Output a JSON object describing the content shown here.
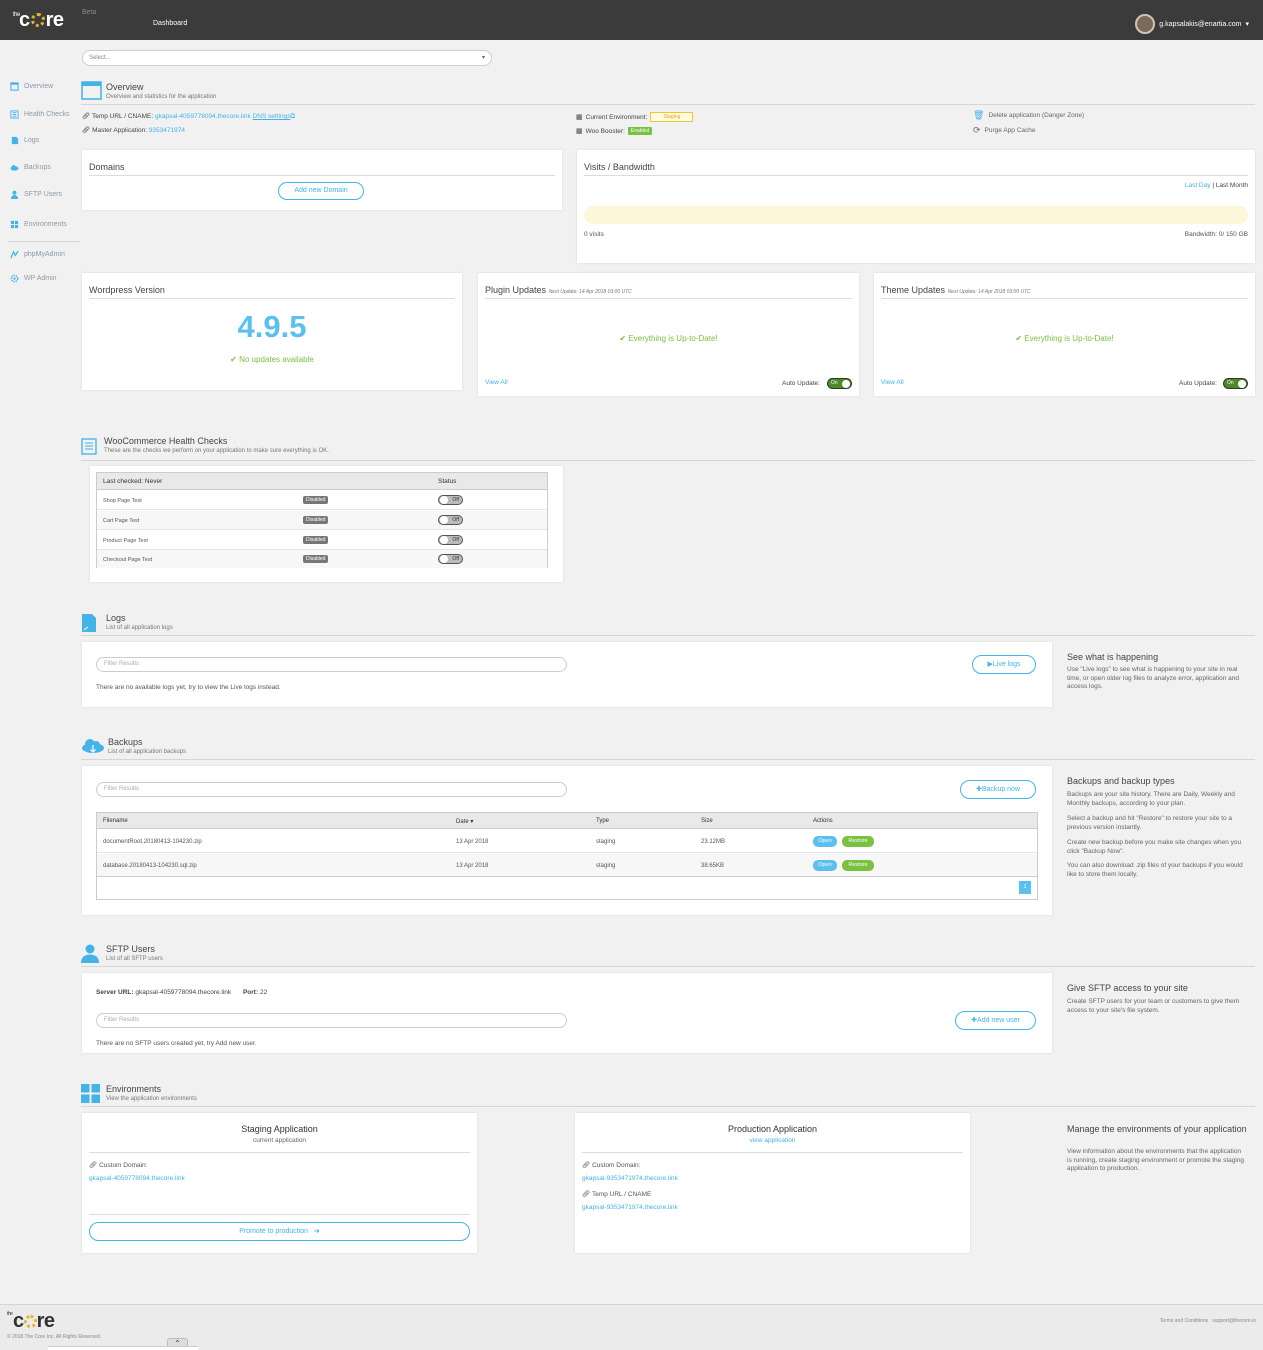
{
  "header": {
    "logo_the": "the",
    "logo_text": "core",
    "beta": "Beta",
    "nav_dashboard": "Dashboard",
    "user_email": "g.kapsalakis@enartia.com"
  },
  "app_select": {
    "placeholder": "Select..."
  },
  "sidebar": {
    "items": [
      {
        "label": "Overview"
      },
      {
        "label": "Health Checks"
      },
      {
        "label": "Logs"
      },
      {
        "label": "Backups"
      },
      {
        "label": "SFTP Users"
      },
      {
        "label": "Environments"
      },
      {
        "label": "phpMyAdmin"
      },
      {
        "label": "WP Admin"
      }
    ]
  },
  "overview": {
    "title": "Overview",
    "subtitle": "Overview and statistics for the application",
    "temp_url_label": "Temp URL / CNAME:",
    "temp_url_value": "gkapsal-4059778094.thecore.link",
    "dns_settings": "DNS settings",
    "master_app_label": "Master Application:",
    "master_app_value": "9353471974",
    "current_env_label": "Current Environment:",
    "current_env_value": "Staging",
    "woo_booster_label": "Woo Booster:",
    "woo_booster_value": "Enabled",
    "delete_app": "Delete application (Danger Zone)",
    "purge_cache": "Purge App Cache"
  },
  "domains": {
    "title": "Domains",
    "add_button": "Add new Domain"
  },
  "visits": {
    "title": "Visits / Bandwidth",
    "last_day": "Last Day",
    "separator": "|",
    "last_month": "Last Month",
    "visits_text": "0 visits",
    "bandwidth_text": "Bandwidth: 0/ 150 GB"
  },
  "wordpress": {
    "title": "Wordpress Version",
    "version": "4.9.5",
    "status": "No updates available"
  },
  "plugins": {
    "title": "Plugin Updates",
    "next_update": "Next Update: 14 Apr 2018 03:00 UTC",
    "status": "Everything is Up-to-Date!",
    "view_all": "View All",
    "auto_update_label": "Auto Update:",
    "toggle_label": "On"
  },
  "themes": {
    "title": "Theme Updates",
    "next_update": "Next Update: 14 Apr 2018 03:00 UTC",
    "status": "Everything is Up-to-Date!",
    "view_all": "View All",
    "auto_update_label": "Auto Update:",
    "toggle_label": "On"
  },
  "health": {
    "title": "WooCommerce Health Checks",
    "subtitle": "These are the checks we perform on your application to make sure everything is OK.",
    "col_last_checked": "Last checked: Never",
    "col_status": "Status",
    "rows": [
      {
        "name": "Shop Page Test",
        "badge": "Disabled",
        "toggle": "Off"
      },
      {
        "name": "Cart Page Test",
        "badge": "Disabled",
        "toggle": "Off"
      },
      {
        "name": "Product Page Test",
        "badge": "Disabled",
        "toggle": "Off"
      },
      {
        "name": "Checkout Page Test",
        "badge": "Disabled",
        "toggle": "Off"
      }
    ]
  },
  "logs": {
    "title": "Logs",
    "subtitle": "List of all application logs",
    "filter_placeholder": "Filter Results",
    "live_logs_button": "Live logs",
    "empty_text": "There are no available logs yet, try to view the Live logs instead.",
    "side_title": "See what is happening",
    "side_body": "Use \"Live logs\" to see what is happening to your site in real time, or open older log files to analyze error, application and access logs."
  },
  "backups": {
    "title": "Backups",
    "subtitle": "List of all application backups",
    "filter_placeholder": "Filter Results",
    "backup_now_button": "Backup now",
    "columns": [
      "Filename",
      "Date ▾",
      "Type",
      "Size",
      "Actions"
    ],
    "rows": [
      {
        "filename": "documentRoot.20180413-104230.zip",
        "date": "13 Apr 2018",
        "type": "staging",
        "size": "23.12MB",
        "open": "Open",
        "restore": "Restore"
      },
      {
        "filename": "database.20180413-104230.sql.zip",
        "date": "13 Apr 2018",
        "type": "staging",
        "size": "38.65KB",
        "open": "Open",
        "restore": "Restore"
      }
    ],
    "page": "1",
    "side_title": "Backups and backup types",
    "side_p1": "Backups are your site history. There are Daily, Weekly and Monthly backups, according to your plan.",
    "side_p2": "Select a backup and hit \"Restore\" to restore your site to a previous version instantly.",
    "side_p3": "Create new backup before you make site changes when you click \"Backup Now\".",
    "side_p4": "You can also download .zip files of your backups if you would like to store them locally."
  },
  "sftp": {
    "title": "SFTP Users",
    "subtitle": "List of all SFTP users",
    "server_url_label": "Server URL:",
    "server_url_value": "gkapsal-4059778094.thecore.link",
    "port_label": "Port:",
    "port_value": "22",
    "filter_placeholder": "Filter Results",
    "add_user_button": "Add new user",
    "empty_text": "There are no SFTP users created yet, try Add new user.",
    "side_title": "Give SFTP access to your site",
    "side_body": "Create SFTP users for your team or customers to give them access to your site's file system."
  },
  "environments": {
    "title": "Environments",
    "subtitle": "View the application environments",
    "staging_title": "Staging Application",
    "staging_sub": "current application",
    "staging_domain_label": "Custom Domain:",
    "staging_domain_value": "gkapsal-4059778094.thecore.link",
    "promote_button": "Promote to production",
    "production_title": "Production Application",
    "production_link": "view application",
    "production_domain_label": "Custom Domain:",
    "production_domain_value": "gkapsal-9353471974.thecore.link",
    "production_temp_label": "Temp URL / CNAME",
    "production_temp_value": "gkapsal-9353471974.thecore.link",
    "side_title": "Manage the environments of your application",
    "side_body": "View information about the environments that the application is running, create staging environment or promote the staging application to production."
  },
  "footer": {
    "logo_the": "the",
    "logo_text": "core",
    "copyright": "© 2018 The Core Inc. All Rights Reserved.",
    "terms": "Terms and Conditions",
    "support": "support@thecore.io",
    "scroll_up": "⌃"
  },
  "colors": {
    "accent": "#43b3e8",
    "success": "#7ac142",
    "header": "#3b3b3b",
    "warning": "#f3c623"
  }
}
